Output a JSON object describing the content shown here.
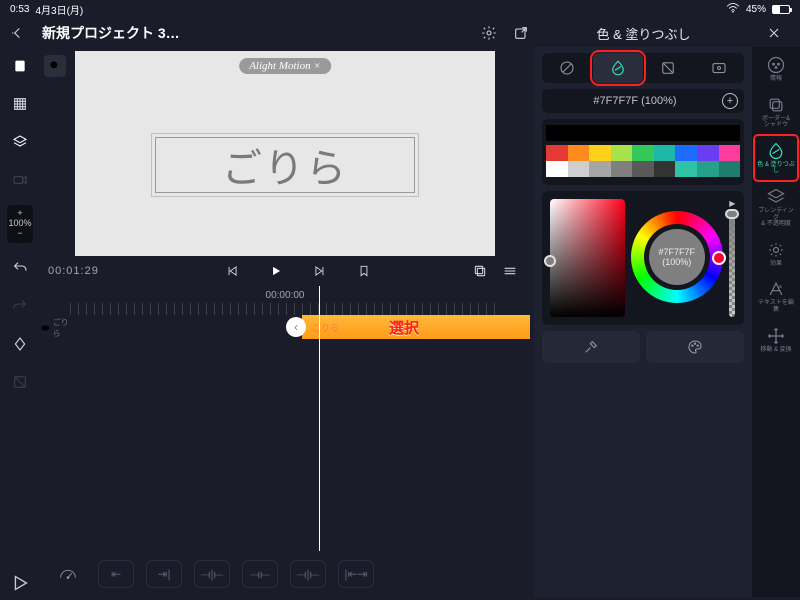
{
  "status": {
    "time": "0:53",
    "date": "4月3日(月)",
    "battery": "45%"
  },
  "header": {
    "project_title": "新規プロジェクト 3…",
    "panel_title": "色 & 塗りつぶし"
  },
  "preview": {
    "watermark": "Alight Motion ×",
    "text_layer": "ごりら"
  },
  "zoom": {
    "plus": "+",
    "value": "100%",
    "minus": "−"
  },
  "transport": {
    "timecode_current": "00:01:29",
    "ruler_label": "00:00:00"
  },
  "timeline": {
    "layer_name": "ごりら",
    "clip_small_label": "ごりら",
    "clip_overlay_label": "選択"
  },
  "color_panel": {
    "current_label": "#7F7F7F (100%)",
    "ring_hex": "#7F7F7F",
    "ring_alpha": "(100%)",
    "swatches_row2": [
      "#e53935",
      "#ff8a1f",
      "#ffd11a",
      "#a7e24a",
      "#34c759",
      "#1fb8a7",
      "#1e6bff",
      "#6a3ef0",
      "#ff3b9e"
    ],
    "swatches_row3": [
      "#ffffff",
      "#cfcfcf",
      "#a6a6a6",
      "#7f7f7f",
      "#595959",
      "#333333",
      "#2fc4a6",
      "#27a08a",
      "#1f7d6e"
    ]
  },
  "right_tabs": {
    "items": [
      {
        "name": "情報"
      },
      {
        "name": "ボーダー&\nシャドウ"
      },
      {
        "name": "色 & 塗りつぶし"
      },
      {
        "name": "ブレンディング\n& 不透明度"
      },
      {
        "name": "効果"
      },
      {
        "name": "テキストを編集"
      },
      {
        "name": "移動 & 変換"
      }
    ]
  }
}
